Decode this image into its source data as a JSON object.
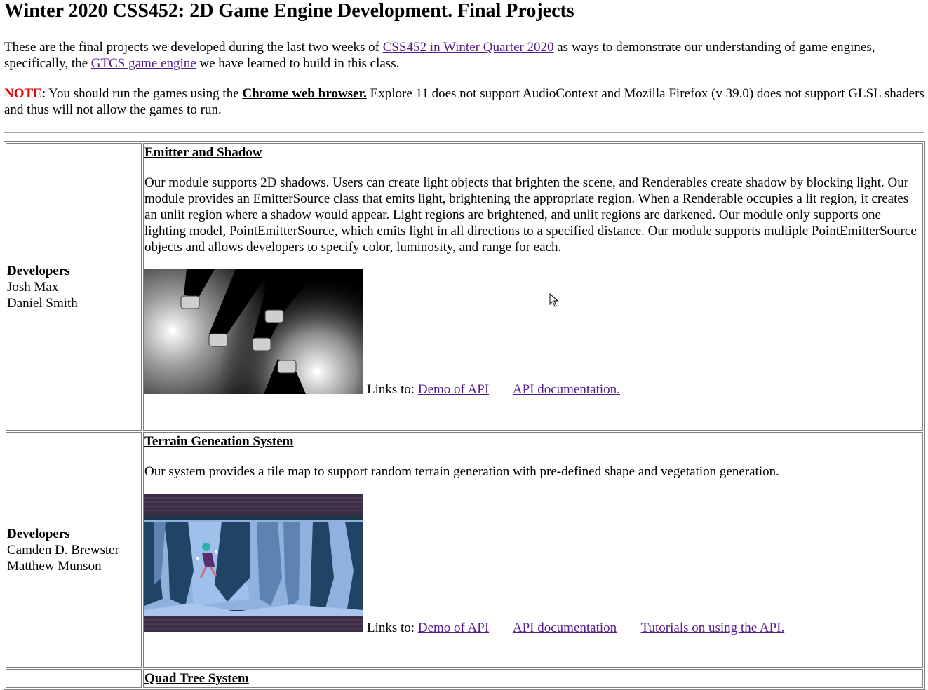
{
  "page": {
    "title": "Winter 2020 CSS452: 2D Game Engine Development. Final Projects",
    "intro_1": "These are the final projects we developed during the last two weeks of ",
    "intro_link_1": "CSS452 in Winter Quarter 2020",
    "intro_2": " as ways to demonstrate our understanding of game engines, specifically, the ",
    "intro_link_2": "GTCS game engine",
    "intro_3": " we have learned to build in this class.",
    "note_label": "NOTE",
    "note_1": ": You should run the games using the ",
    "note_link": "Chrome web browser.",
    "note_2": " Explore 11 does not support AudioContext and Mozilla Firefox (v 39.0) does not support GLSL shaders and thus will not allow the games to run."
  },
  "projects": [
    {
      "dev_heading": "Developers",
      "developers": [
        "Josh Max",
        "Daniel Smith"
      ],
      "title": "Emitter and Shadow",
      "description": "Our module supports 2D shadows. Users can create light objects that brighten the scene, and Renderables create shadow by blocking light. Our module provides an EmitterSource class that emits light, brightening the appropriate region. When a Renderable occupies a lit region, it creates an unlit region where a shadow would appear. Light regions are brightened, and unlit regions are darkened. Our module only supports one lighting model, PointEmitterSource, which emits light in all directions to a specified distance. Our module supports multiple PointEmitterSource objects and allows developers to specify color, luminosity, and range for each.",
      "links_label": "Links to:",
      "links": [
        "Demo of API",
        "API documentation."
      ]
    },
    {
      "dev_heading": "Developers",
      "developers": [
        "Camden D. Brewster",
        "Matthew Munson"
      ],
      "title": "Terrain Geneation System",
      "description": "Our system provides a tile map to support random terrain generation with pre-defined shape and vegetation generation.",
      "links_label": "Links to:",
      "links": [
        "Demo of API",
        "API documentation",
        "Tutorials on using the API."
      ]
    },
    {
      "title": "Quad Tree System"
    }
  ],
  "colors": {
    "link": "#551a8b",
    "note": "#e00000"
  },
  "icons": [
    "mouse-cursor-icon"
  ]
}
